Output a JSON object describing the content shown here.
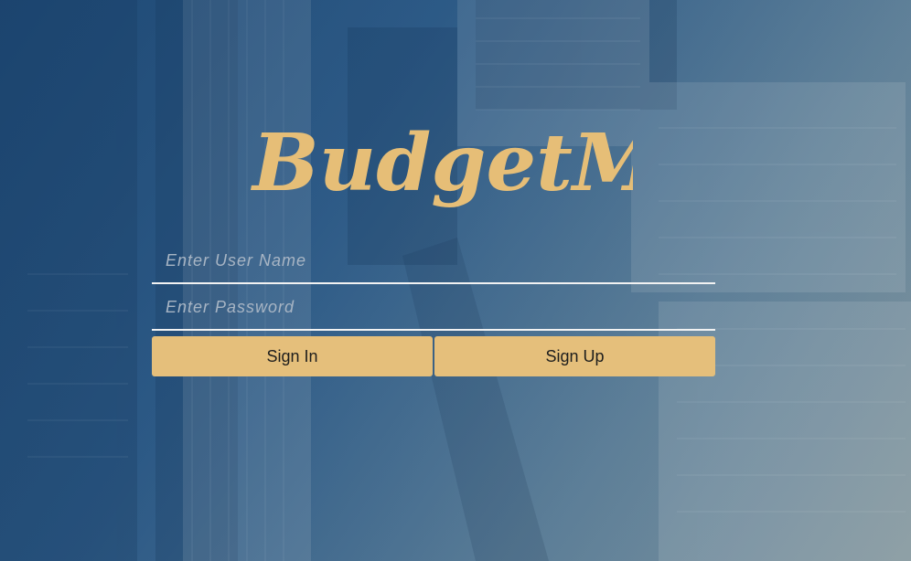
{
  "brand": {
    "logo_text": "BudgetMe",
    "accent_color": "#e5bf7b"
  },
  "login_form": {
    "username": {
      "placeholder": "Enter User Name",
      "value": ""
    },
    "password": {
      "placeholder": "Enter Password",
      "value": ""
    },
    "sign_in_label": "Sign In",
    "sign_up_label": "Sign Up"
  },
  "background": {
    "description_icon": "city-aerial-background",
    "tint_color": "#2a5580"
  }
}
